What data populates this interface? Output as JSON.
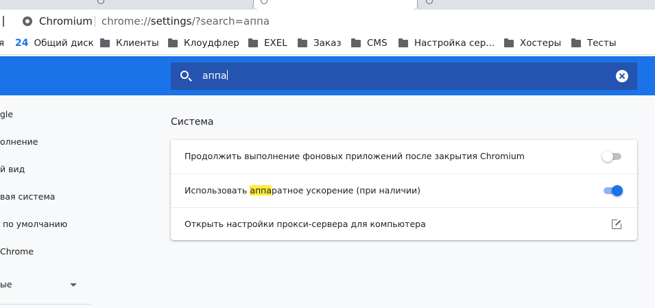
{
  "browser": {
    "site_name": "Chromium",
    "url_prefix": "chrome://",
    "url_host": "settings",
    "url_rest": "/?search=аппа"
  },
  "bookmarks": {
    "cut_item": "я",
    "badge_num": "24",
    "items": [
      "Общий диск",
      "Клиенты",
      "Клоудфлер",
      "EXEL",
      "Заказ",
      "CMS",
      "Настройка сер...",
      "Хостеры",
      "Тесты"
    ]
  },
  "search": {
    "query": "аппа"
  },
  "nav": {
    "items": [
      "gle",
      "олнение",
      "й вид",
      "вая система",
      "по умолчанию",
      "Chrome",
      "ые"
    ]
  },
  "section": {
    "title": "Система",
    "rows": [
      {
        "label": "Продолжить выполнение фоновых приложений после закрытия Chromium",
        "toggle": "off"
      },
      {
        "label_before": "Использовать ",
        "label_highlight": "аппа",
        "label_after": "ратное ускорение (при наличии)",
        "toggle": "on"
      },
      {
        "label": "Открыть настройки прокси-сервера для компьютера",
        "icon": "open-external-icon"
      }
    ]
  },
  "colors": {
    "accent": "#1a73e8",
    "highlight": "#ffeb3b"
  }
}
